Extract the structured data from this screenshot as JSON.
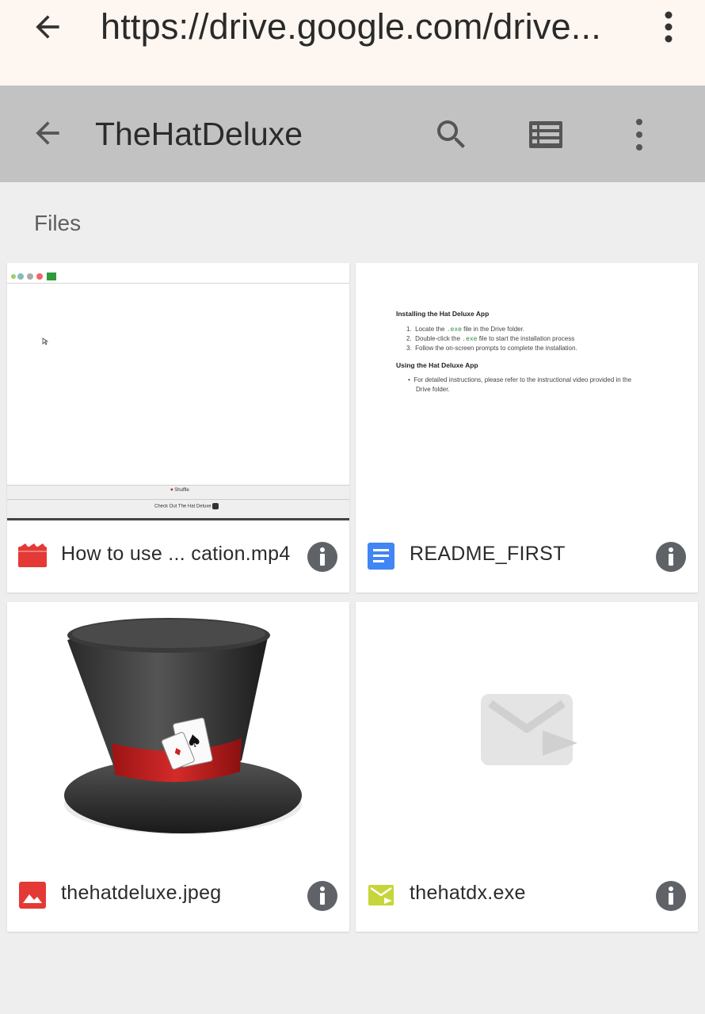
{
  "browser": {
    "url": "https://drive.google.com/drive..."
  },
  "appbar": {
    "title": "TheHatDeluxe"
  },
  "section_label": "Files",
  "files": [
    {
      "name": "How to use ... cation.mp4",
      "type": "video",
      "icon": "video-file-icon",
      "icon_color": "#e53935",
      "thumb": {
        "shuffle_label": "Shuffle",
        "bottom_label": "Check Out The Hat Deluxe"
      }
    },
    {
      "name": "README_FIRST",
      "type": "document",
      "icon": "docs-file-icon",
      "icon_color": "#4285f4",
      "thumb": {
        "heading1": "Installing the Hat Deluxe App",
        "steps": [
          {
            "num": "1.",
            "pre": "Locate the ",
            "code": ".exe",
            "post": " file in the Drive folder."
          },
          {
            "num": "2.",
            "pre": "Double-click the ",
            "code": ".exe",
            "post": " file to start the installation process"
          },
          {
            "num": "3.",
            "pre": "Follow the on-screen prompts to complete the installation.",
            "code": "",
            "post": ""
          }
        ],
        "heading2": "Using the Hat Deluxe App",
        "bullet_line1": "For detailed instructions, please refer to the instructional video provided in the",
        "bullet_line2": "Drive folder."
      }
    },
    {
      "name": "thehatdeluxe.jpeg",
      "type": "image",
      "icon": "image-file-icon",
      "icon_color": "#e53935"
    },
    {
      "name": "thehatdx.exe",
      "type": "executable",
      "icon": "exe-file-icon",
      "icon_color": "#c6d63a"
    }
  ]
}
